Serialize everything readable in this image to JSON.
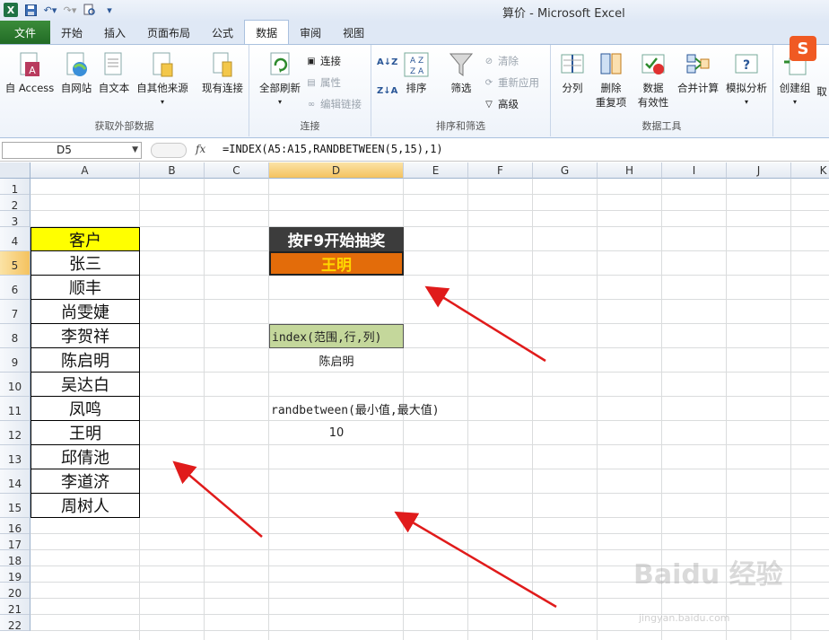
{
  "app": {
    "window_title": "算价 - Microsoft Excel"
  },
  "tabs": [
    {
      "label": "文件"
    },
    {
      "label": "开始"
    },
    {
      "label": "插入"
    },
    {
      "label": "页面布局"
    },
    {
      "label": "公式"
    },
    {
      "label": "数据"
    },
    {
      "label": "审阅"
    },
    {
      "label": "视图"
    }
  ],
  "ribbon": {
    "get_external": {
      "label": "获取外部数据",
      "access": "自 Access",
      "web": "自网站",
      "text": "自文本",
      "other": "自其他来源",
      "existing": "现有连接"
    },
    "connections": {
      "label": "连接",
      "refresh_all": "全部刷新",
      "connections": "连接",
      "properties": "属性",
      "edit_links": "编辑链接"
    },
    "sort_filter": {
      "label": "排序和筛选",
      "sort": "排序",
      "filter": "筛选",
      "clear": "清除",
      "reapply": "重新应用",
      "advanced": "高级"
    },
    "data_tools": {
      "label": "数据工具",
      "split": "分列",
      "remove_dup_1": "删除",
      "remove_dup_2": "重复项",
      "validation_1": "数据",
      "validation_2": "有效性",
      "consolidate": "合并计算",
      "whatif": "模拟分析"
    },
    "outline": {
      "group": "创建组",
      "ungroup": "取"
    }
  },
  "formula_bar": {
    "name_box": "D5",
    "fx": "fx",
    "formula": "=INDEX(A5:A15,RANDBETWEEN(5,15),1)"
  },
  "columns": [
    "A",
    "B",
    "C",
    "D",
    "E",
    "F",
    "G",
    "H",
    "I",
    "J",
    "K"
  ],
  "rows": [
    "1",
    "2",
    "3",
    "4",
    "5",
    "6",
    "7",
    "8",
    "9",
    "10",
    "11",
    "12",
    "13",
    "14",
    "15",
    "16",
    "17",
    "18",
    "19",
    "20",
    "21",
    "22"
  ],
  "sheet": {
    "customer_header": "客户",
    "customers": [
      "张三",
      "顺丰",
      "尚雯婕",
      "李贺祥",
      "陈启明",
      "吴达白",
      "凤鸣",
      "王明",
      "邱倩池",
      "李道济",
      "周树人"
    ],
    "banner": "按F9开始抽奖",
    "winner": "王明",
    "index_hint": "index(范围,行,列)",
    "index_result": "陈启明",
    "randbetween_hint": "randbetween(最小值,最大值)",
    "randbetween_result": "10"
  },
  "overlay": {
    "ime_logo": "S",
    "watermark": "Baidu 经验",
    "watermark_url": "jingyan.baidu.com"
  },
  "colors": {
    "file_tab": "#2e7d32",
    "header_yellow": "#ffff00",
    "banner_dark": "#3c3c3c",
    "winner_orange": "#e36c0a",
    "winner_text": "#ffd700",
    "hint_green": "#c4d79b",
    "arrow_red": "#e01b1b"
  }
}
